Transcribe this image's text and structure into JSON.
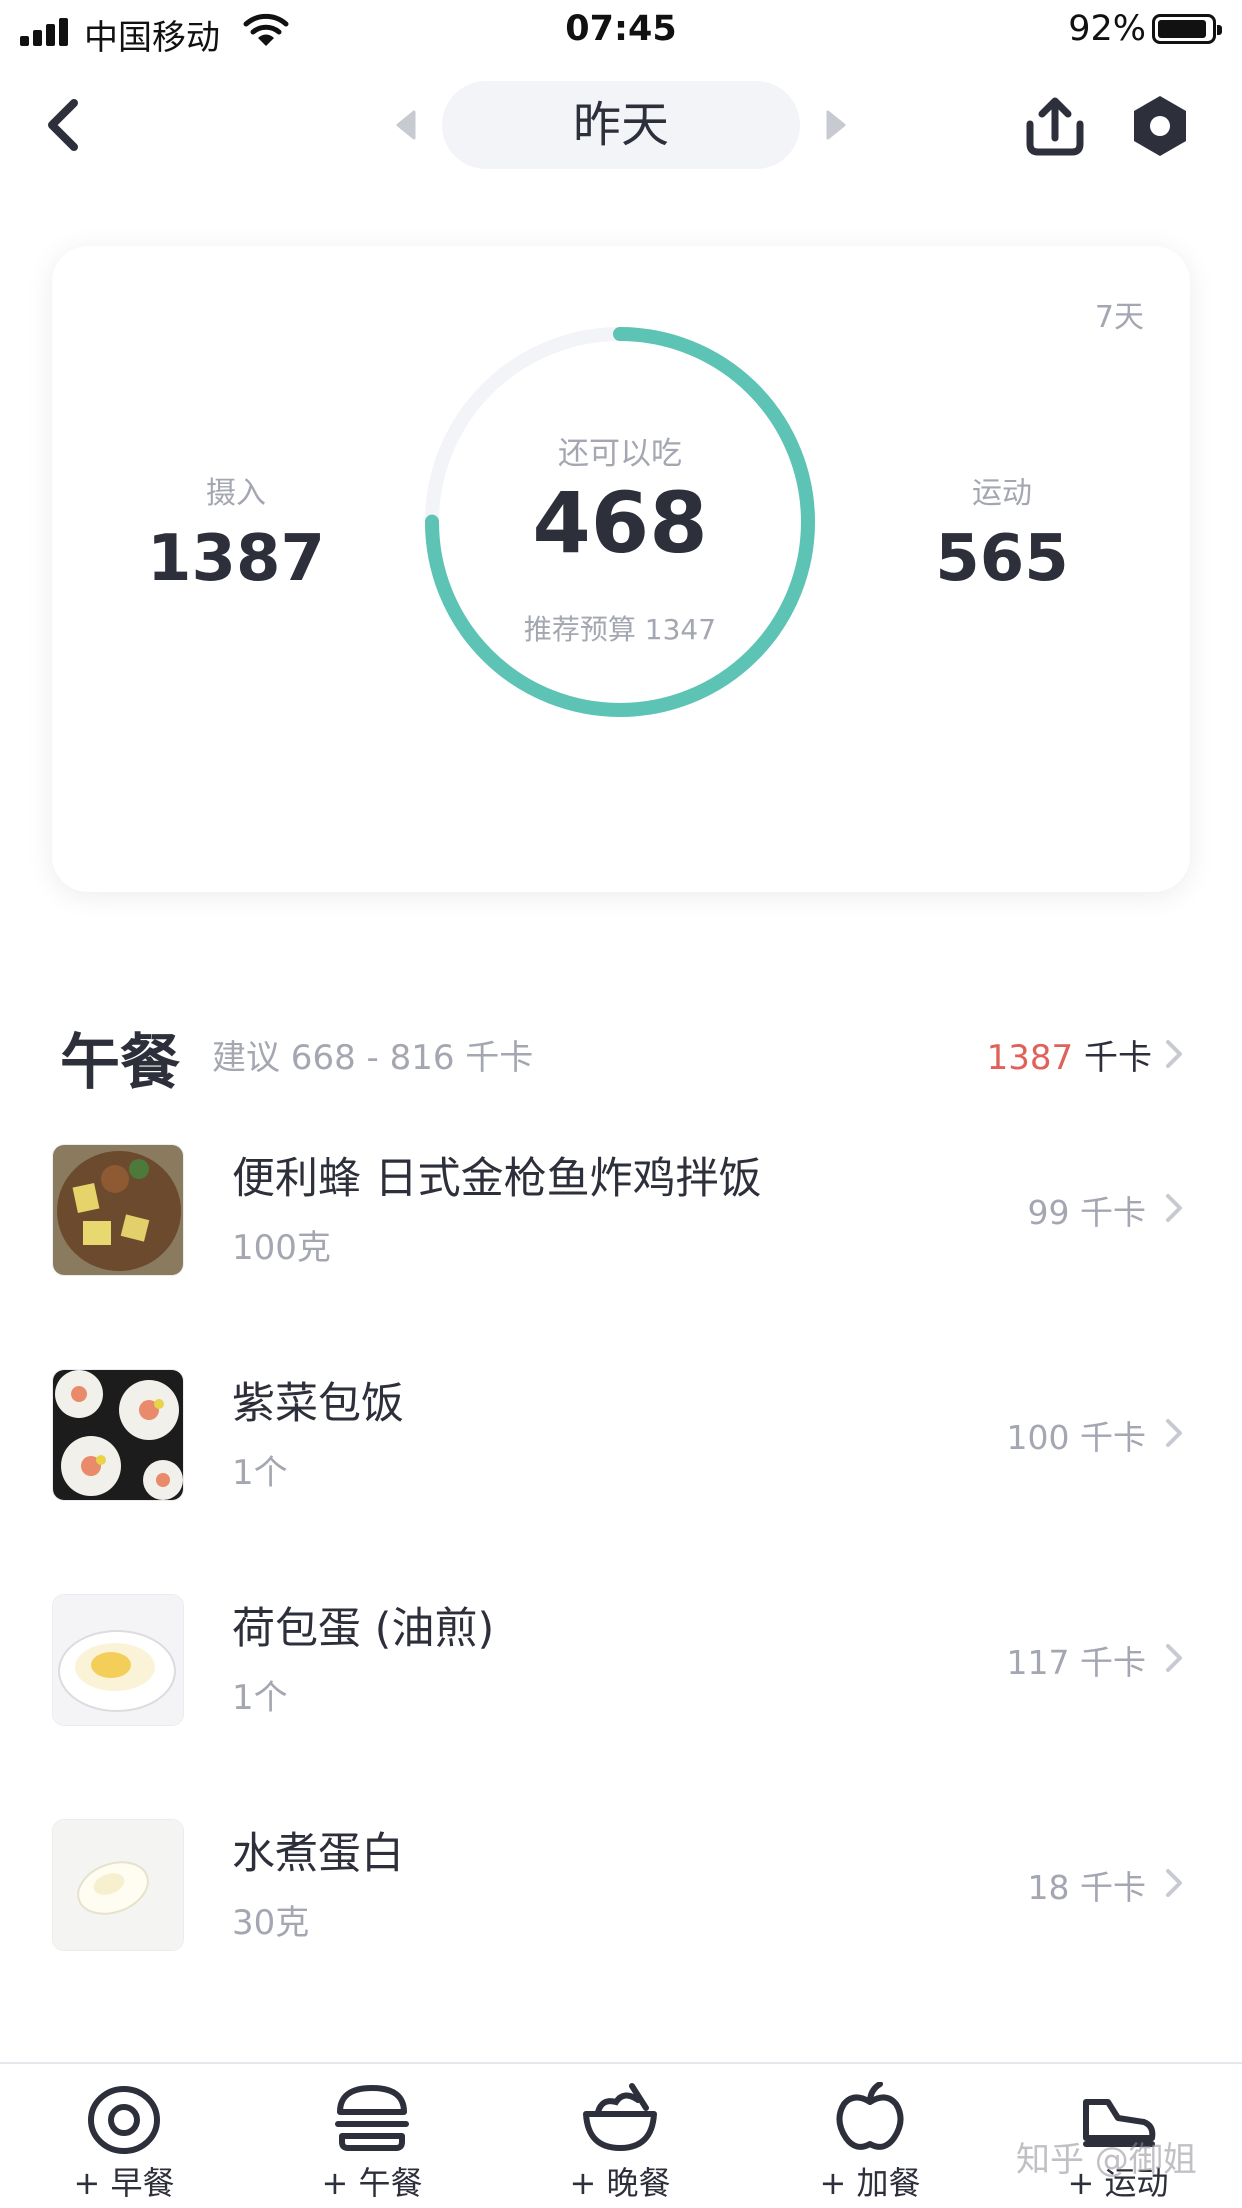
{
  "status_bar": {
    "carrier": "中国移动",
    "time": "07:45",
    "battery": "92%",
    "battery_level": 0.92
  },
  "nav": {
    "date_label": "昨天"
  },
  "summary": {
    "range_label": "7天",
    "intake_label": "摄入",
    "intake_value": "1387",
    "remaining_label": "还可以吃",
    "remaining_value": "468",
    "budget_text": "推荐预算 1347",
    "exercise_label": "运动",
    "exercise_value": "565",
    "ring_color": "#5cc3b5",
    "ring_track_color": "#f3f4f8",
    "ring_progress_fraction": 0.75
  },
  "meal": {
    "title": "午餐",
    "suggestion": "建议 668 - 816 千卡",
    "total_value": "1387",
    "total_unit": "千卡",
    "total_color": "#e0605a"
  },
  "foods": [
    {
      "name": "便利蜂 日式金枪鱼炸鸡拌饭",
      "amount": "100克",
      "calories": "99 千卡"
    },
    {
      "name": "紫菜包饭",
      "amount": "1个",
      "calories": "100 千卡"
    },
    {
      "name": "荷包蛋 (油煎)",
      "amount": "1个",
      "calories": "117 千卡"
    },
    {
      "name": "水煮蛋白",
      "amount": "30克",
      "calories": "18 千卡"
    }
  ],
  "tabs": [
    {
      "label": "+ 早餐",
      "icon": "egg-icon"
    },
    {
      "label": "+ 午餐",
      "icon": "burger-icon"
    },
    {
      "label": "+ 晚餐",
      "icon": "bowl-icon"
    },
    {
      "label": "+ 加餐",
      "icon": "apple-icon"
    },
    {
      "label": "+ 运动",
      "icon": "shoe-icon"
    }
  ],
  "watermark": "知乎 @御姐"
}
